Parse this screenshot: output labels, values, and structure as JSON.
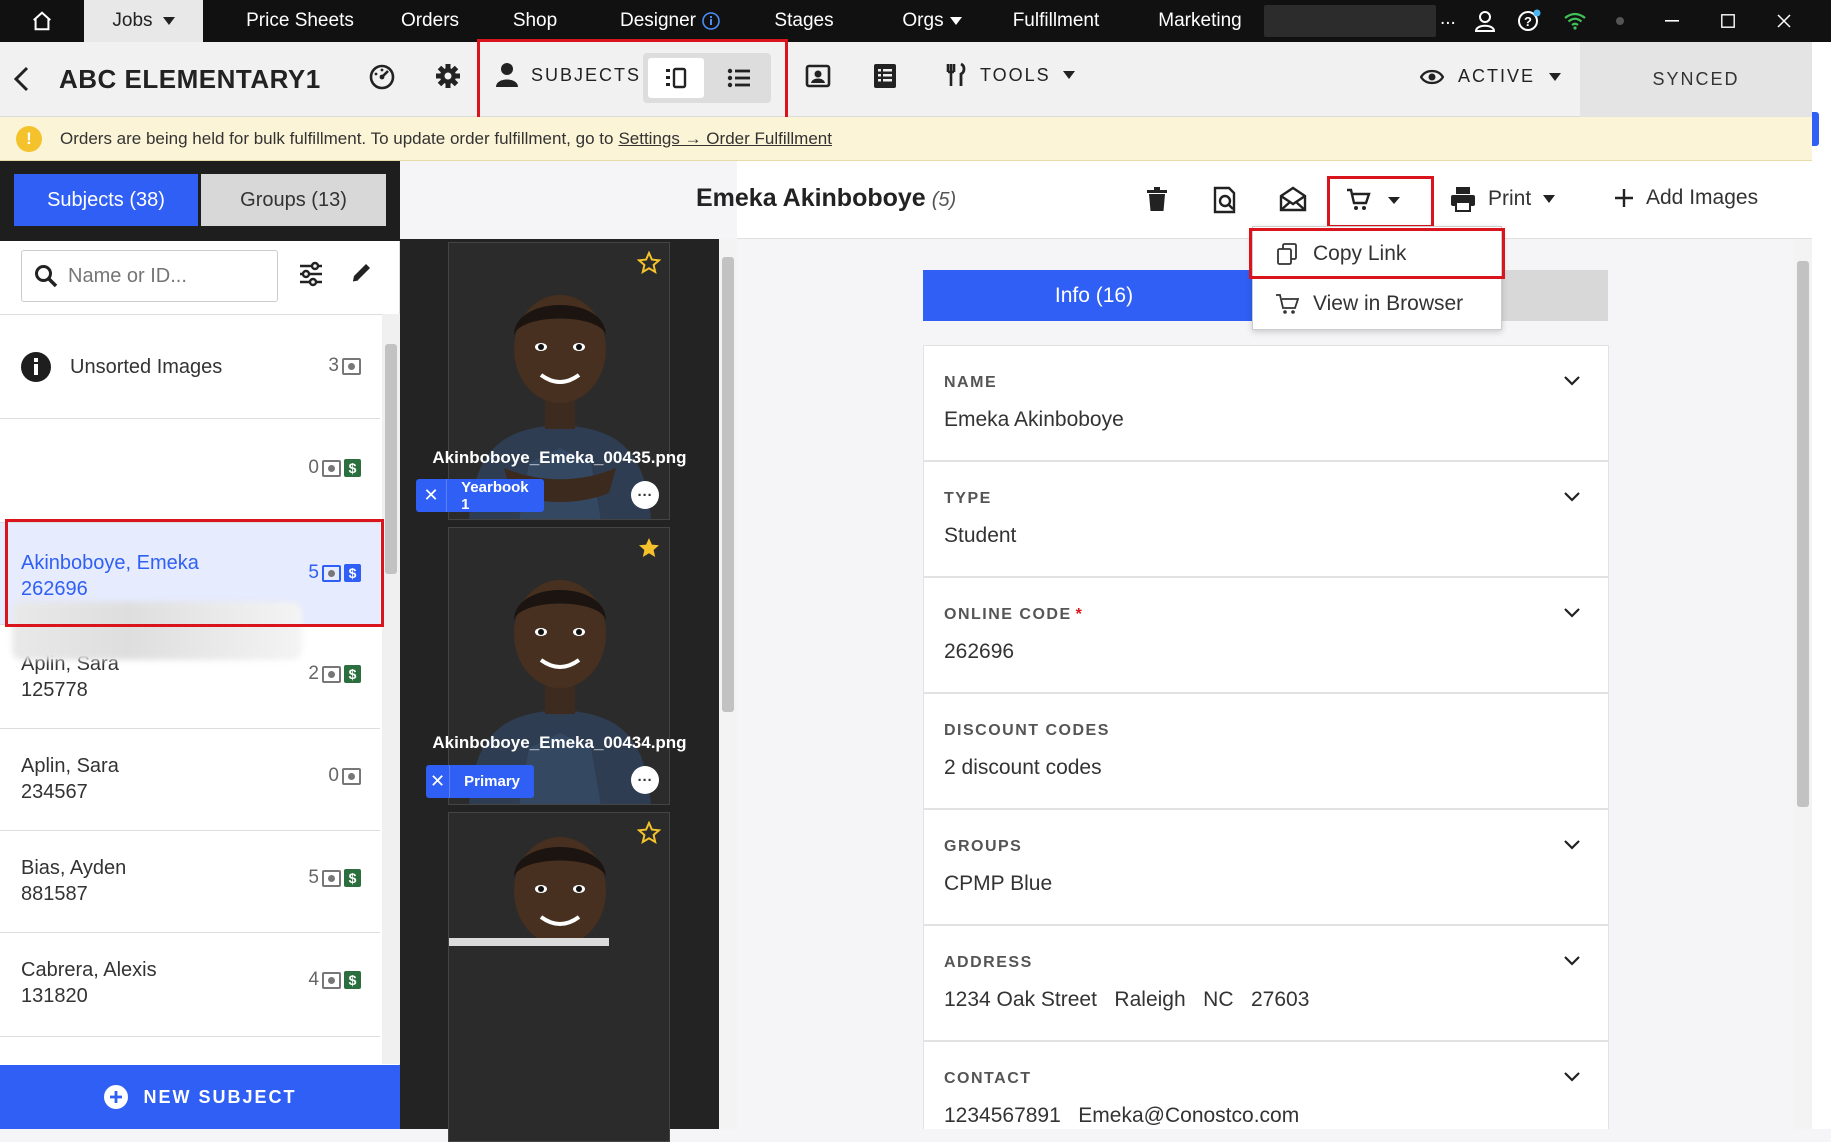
{
  "topnav": {
    "jobs_label": "Jobs",
    "items": [
      "Price Sheets",
      "Orders",
      "Shop",
      "Designer",
      "Stages",
      "Orgs",
      "Fulfillment",
      "Marketing"
    ],
    "ellipsis": "..."
  },
  "toolbar": {
    "job_title": "ABC ELEMENTARY1",
    "subjects_label": "SUBJECTS",
    "tools_label": "TOOLS",
    "status_label": "ACTIVE",
    "sync_label": "SYNCED"
  },
  "banner": {
    "message": "Orders are being held for bulk fulfillment. To update order fulfillment, go to",
    "link": "Settings → Order Fulfillment"
  },
  "sidebar": {
    "tab_subjects": "Subjects (38)",
    "tab_groups": "Groups (13)",
    "search_placeholder": "Name or ID...",
    "unsorted_label": "Unsorted Images",
    "unsorted_count": "3",
    "blurred_count": "0",
    "subjects": [
      {
        "last_first": "Akinboboye, Emeka",
        "id": "262696",
        "count": "5",
        "paid": true
      },
      {
        "last_first": "Aplin, Sara",
        "id": "125778",
        "count": "2",
        "paid": true
      },
      {
        "last_first": "Aplin, Sara",
        "id": "234567",
        "count": "0",
        "paid": false
      },
      {
        "last_first": "Bias, Ayden",
        "id": "881587",
        "count": "5",
        "paid": true
      },
      {
        "last_first": "Cabrera, Alexis",
        "id": "131820",
        "count": "4",
        "paid": true
      }
    ],
    "new_subject_label": "NEW SUBJECT"
  },
  "images": [
    {
      "filename": "Akinboboye_Emeka_00435.png",
      "tag": "Yearbook 1",
      "starred": false
    },
    {
      "filename": "Akinboboye_Emeka_00434.png",
      "tag": "Primary",
      "starred": true
    }
  ],
  "subject": {
    "name": "Emeka Akinboboye",
    "image_count": "(5)"
  },
  "header": {
    "print_label": "Print",
    "add_images_label": "Add Images"
  },
  "cart_menu": {
    "copy_link": "Copy Link",
    "view_in_browser": "View in Browser"
  },
  "info": {
    "tab_label": "Info (16)",
    "fields": [
      {
        "label": "NAME",
        "value": "Emeka Akinboboye"
      },
      {
        "label": "TYPE",
        "value": "Student"
      },
      {
        "label": "ONLINE CODE",
        "value": "262696",
        "required_mark": "*"
      },
      {
        "label": "DISCOUNT CODES",
        "value": "2 discount codes"
      },
      {
        "label": "GROUPS",
        "value": "CPMP Blue"
      },
      {
        "label": "ADDRESS",
        "value": "1234 Oak Street   Raleigh   NC   27603"
      },
      {
        "label": "CONTACT",
        "value": "1234567891   Emeka@Conostco.com"
      }
    ]
  },
  "colors": {
    "accent": "#2f5ff5",
    "highlight": "#d9141c",
    "banner": "#fbf4d6",
    "paid": "#2b6f3e"
  }
}
